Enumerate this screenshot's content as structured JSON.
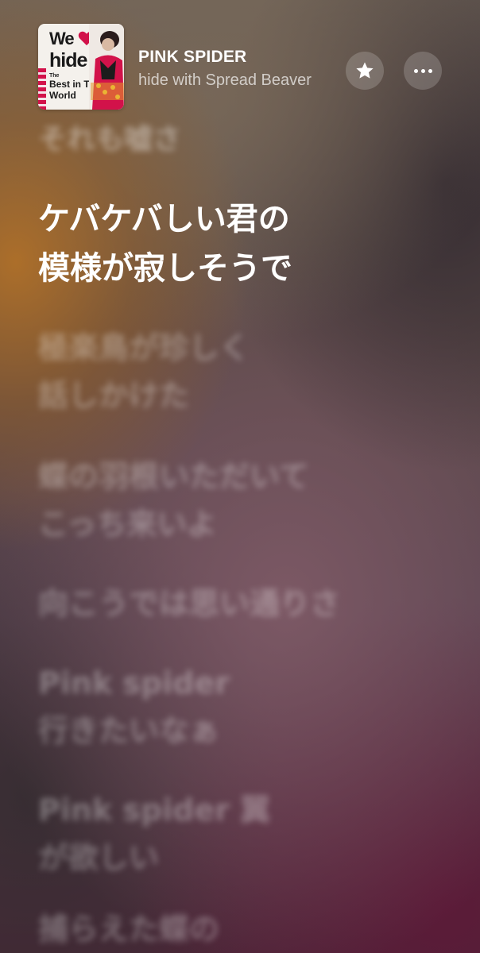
{
  "now_playing": {
    "title": "PINK SPIDER",
    "artist": "hide with Spread Beaver",
    "artwork": {
      "we": "We",
      "hide": "hide",
      "the": "The",
      "best": "Best in The",
      "world": "World",
      "accent_color": "#d2124a"
    }
  },
  "controls": {
    "favorite_icon": "star-icon",
    "more_icon": "ellipsis-icon"
  },
  "lyrics": {
    "previous": [
      "それも嘘さ"
    ],
    "current": [
      "ケバケバしい君の",
      "模様が寂しそうで"
    ],
    "upcoming": [
      [
        "極楽鳥が珍しく",
        "話しかけた"
      ],
      [
        "蝶の羽根いただいて",
        "こっち来いよ"
      ],
      [
        "向こうでは思い通りさ"
      ],
      [
        "Pink spider",
        "行きたいなぁ"
      ],
      [
        "Pink spider 翼",
        "が欲しい"
      ],
      [
        "捕らえた蝶の"
      ]
    ]
  }
}
